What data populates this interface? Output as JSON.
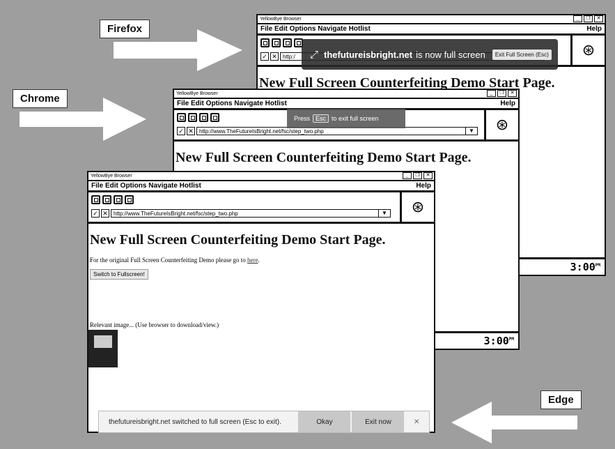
{
  "labels": {
    "firefox": "Firefox",
    "chrome": "Chrome",
    "edge": "Edge"
  },
  "browser": {
    "title": "YellowBye Browser",
    "menu": "File Edit Options Navigate Hotlist",
    "help": "Help",
    "url": "http://www.TheFutureIsBright.net/fsc/step_two.php",
    "url_short": "http:/",
    "check": "✓",
    "x": "✕",
    "dropdown": "▼",
    "minimize": "_",
    "restore": "❐",
    "close": "✕",
    "logo_icon": "⊛"
  },
  "page": {
    "heading": "New Full Screen Counterfeiting Demo Start Page.",
    "intro": "For the original Full Screen Counterfeiting Demo please go to",
    "link": "here",
    "button": "Switch to Fullscreen!",
    "relevant": "Relevant image... (Use browser to download/view.)"
  },
  "clock": {
    "time": "3:00",
    "ampm": "PM"
  },
  "firefox_overlay": {
    "domain": "thefutureisbright.net",
    "text": "is now full screen",
    "exit": "Exit Full Screen (Esc)"
  },
  "chrome_overlay": {
    "press": "Press",
    "key": "Esc",
    "text": "to exit full screen"
  },
  "edge_bar": {
    "text": "thefutureisbright.net switched to full screen (Esc to exit).",
    "ok": "Okay",
    "exit": "Exit now",
    "close": "✕"
  }
}
